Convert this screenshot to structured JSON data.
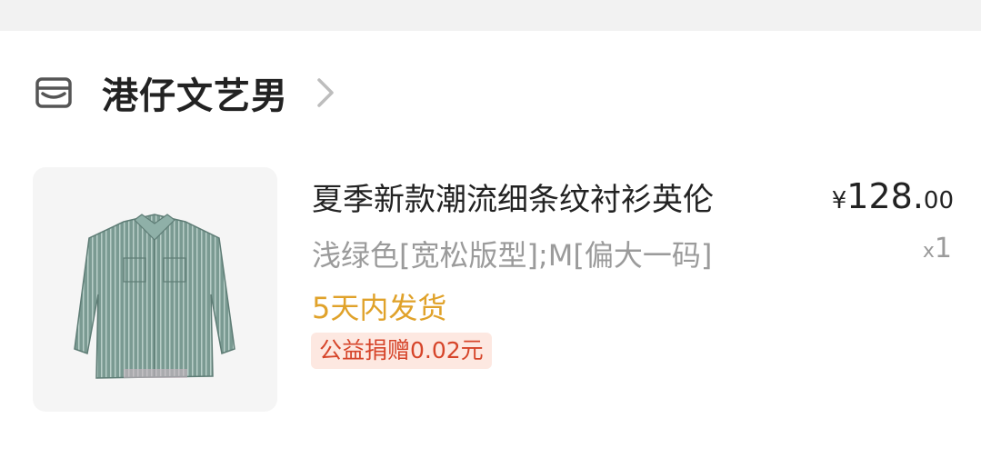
{
  "shop": {
    "name": "港仔文艺男",
    "icon": "store-icon",
    "chevron_icon": "chevron-right-icon"
  },
  "product": {
    "image": "shirt-image",
    "title": "夏季新款潮流细条纹衬衫英伦",
    "spec": "浅绿色[宽松版型];M[偏大一码]",
    "shipping": "5天内发货",
    "charity": "公益捐赠0.02元",
    "price": {
      "symbol": "¥",
      "integer": "128.",
      "decimal": "00"
    },
    "quantity": {
      "prefix": "x",
      "value": "1"
    }
  },
  "colors": {
    "shipping": "#e0a22a",
    "charity_text": "#d6452a",
    "charity_bg": "#fde8e1",
    "secondary_text": "#9b9b9b"
  }
}
